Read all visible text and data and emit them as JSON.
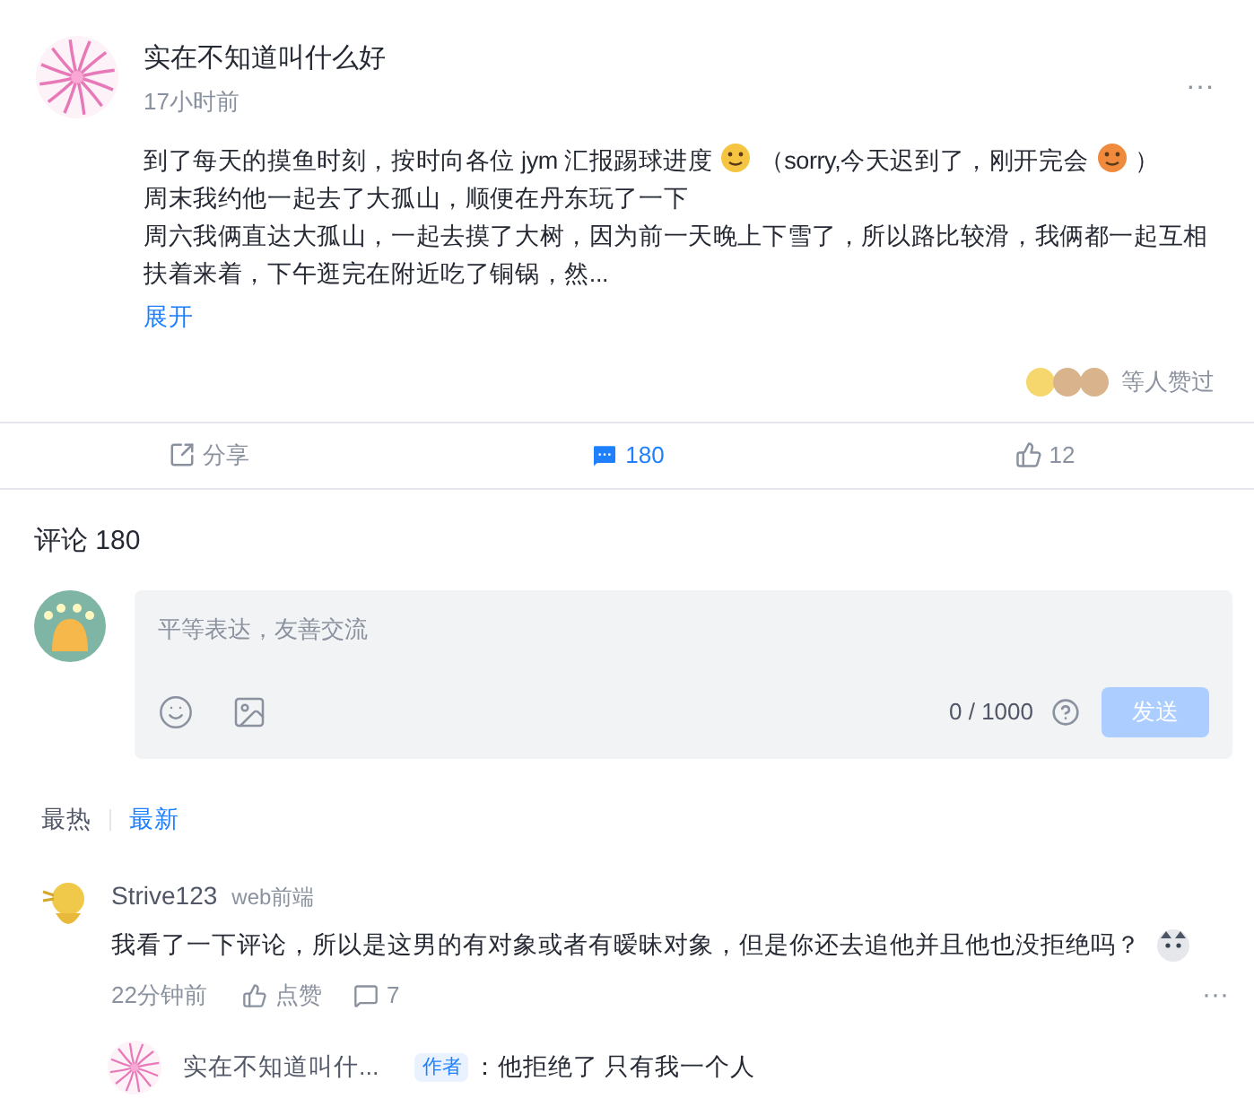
{
  "post": {
    "author": "实在不知道叫什么好",
    "time": "17小时前",
    "more": "···",
    "body": [
      {
        "kind": "text",
        "text": "到了每天的摸鱼时刻，按时向各位 jym 汇报踢球进度"
      },
      {
        "kind": "emoji",
        "color": "#f5c542"
      },
      {
        "kind": "text",
        "text": "（sorry,今天迟到了，刚开完会"
      },
      {
        "kind": "emoji",
        "color": "#f08a3c"
      },
      {
        "kind": "text",
        "text": "）"
      },
      {
        "kind": "break"
      },
      {
        "kind": "text",
        "text": "周末我约他一起去了大孤山，顺便在丹东玩了一下"
      },
      {
        "kind": "break"
      },
      {
        "kind": "text",
        "text": "周六我俩直达大孤山，一起去摸了大树，因为前一天晚上下雪了，所以路比较滑，我俩都一起互相扶着来着，下午逛完在附近吃了铜锅，然..."
      }
    ],
    "expand": "展开",
    "liked_by": "等人赞过"
  },
  "actions": [
    {
      "kind": "share",
      "label": "分享",
      "selected": false
    },
    {
      "kind": "comment",
      "label": "180",
      "selected": true
    },
    {
      "kind": "like",
      "label": "12",
      "selected": false
    }
  ],
  "comments_title": "评论 180",
  "editor": {
    "placeholder": "平等表达，友善交流",
    "counter": "0 / 1000",
    "submit": "发送",
    "disabled": true
  },
  "sort_tabs": [
    {
      "label": "最热",
      "selected": false
    },
    {
      "label": "最新",
      "selected": true
    }
  ],
  "comments": [
    {
      "author": "Strive123",
      "tag": "web前端",
      "text": "我看了一下评论，所以是这男的有对象或者有暧昧对象，但是你还去追他并且他也没拒绝吗？",
      "time": "22分钟前",
      "like": "点赞",
      "replies": "7",
      "more": "···",
      "reply": {
        "author": "实在不知道叫什...",
        "badge": "作者",
        "text": "：他拒绝了 只有我一个人"
      }
    }
  ]
}
